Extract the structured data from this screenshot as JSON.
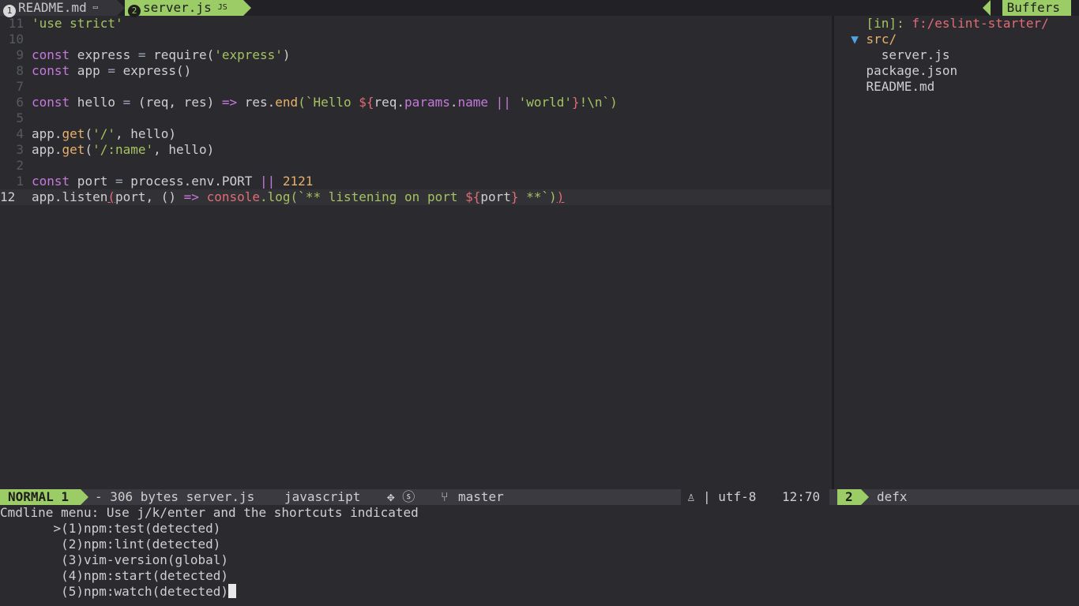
{
  "tabline": {
    "tab1_num": "1",
    "tab1_name": "README.md",
    "tab1_icon": "▭",
    "tab2_num": "2",
    "tab2_name": "server.js",
    "tab2_icon": "JS",
    "buffers_label": "Buffers"
  },
  "editor": {
    "lines": [
      {
        "num": "11",
        "current": false
      },
      {
        "num": "10",
        "current": false
      },
      {
        "num": "9",
        "current": false
      },
      {
        "num": "8",
        "current": false
      },
      {
        "num": "7",
        "current": false
      },
      {
        "num": "6",
        "current": false
      },
      {
        "num": "5",
        "current": false
      },
      {
        "num": "4",
        "current": false
      },
      {
        "num": "3",
        "current": false
      },
      {
        "num": "2",
        "current": false
      },
      {
        "num": "1",
        "current": false
      },
      {
        "num": "12",
        "current": true
      }
    ],
    "code": {
      "l11": "'use strict'",
      "l9_kw": "const",
      "l9_a": " express ",
      "l9_op": "=",
      "l9_b": " require(",
      "l9_str": "'express'",
      "l9_c": ")",
      "l8_kw": "const",
      "l8_a": " app ",
      "l8_op": "=",
      "l8_b": " express()",
      "l6_kw": "const",
      "l6_a": " hello ",
      "l6_op": "=",
      "l6_b": " (req, res) ",
      "l6_arrow": "=>",
      "l6_c": " res.",
      "l6_fn": "end",
      "l6_d": "(`Hello ",
      "l6_tpl1": "${",
      "l6_e": "req.",
      "l6_prop1": "params",
      "l6_f": ".",
      "l6_prop2": "name",
      "l6_g": " ",
      "l6_or": "||",
      "l6_h": " ",
      "l6_str": "'world'",
      "l6_tpl2": "}",
      "l6_i": "!\\n`)",
      "l4_a": "app.",
      "l4_fn": "get",
      "l4_b": "(",
      "l4_str": "'/'",
      "l4_c": ", hello)",
      "l3_a": "app.",
      "l3_fn": "get",
      "l3_b": "(",
      "l3_str": "'/:name'",
      "l3_c": ", hello)",
      "l1_kw": "const",
      "l1_a": " port ",
      "l1_op": "=",
      "l1_b": " process.env.PORT ",
      "l1_or": "||",
      "l1_c": " ",
      "l1_num": "2121",
      "l12_a": "app.listen",
      "l12_paren1": "(",
      "l12_b": "port, () ",
      "l12_arrow": "=>",
      "l12_c": " ",
      "l12_console": "console",
      "l12_d": ".log(`** listening on port ",
      "l12_tpl1": "${",
      "l12_e": "port",
      "l12_tpl2": "}",
      "l12_f": " **`)",
      "l12_paren2": ")"
    }
  },
  "tree": {
    "in_label": "[in]:",
    "path": " f:/eslint-starter/",
    "arrow": "▼",
    "dir": "src/",
    "file1": "server.js",
    "file2": "package.json",
    "file3": "README.md"
  },
  "status": {
    "mode": "NORMAL 1",
    "file_info": "- 306 bytes server.js",
    "filetype": "javascript",
    "icons": "✥ ⓢ",
    "branch_icon": "⑂",
    "branch": "master",
    "warn_icon": "♙",
    "encoding": "| utf-8",
    "position": "12:70",
    "panel_num": "2",
    "panel_name": "defx"
  },
  "cmdline": {
    "header": "Cmdline menu: Use j/k/enter and the shortcuts indicated",
    "selector": ">",
    "items": [
      "(1)npm:test(detected)",
      "(2)npm:lint(detected)",
      "(3)vim-version(global)",
      "(4)npm:start(detected)",
      "(5)npm:watch(detected)"
    ]
  },
  "colors": {
    "accent": "#9ccc65",
    "background": "#2b2b2f",
    "keyword": "#c678dd",
    "string": "#a5c261",
    "error": "#e06c75"
  }
}
